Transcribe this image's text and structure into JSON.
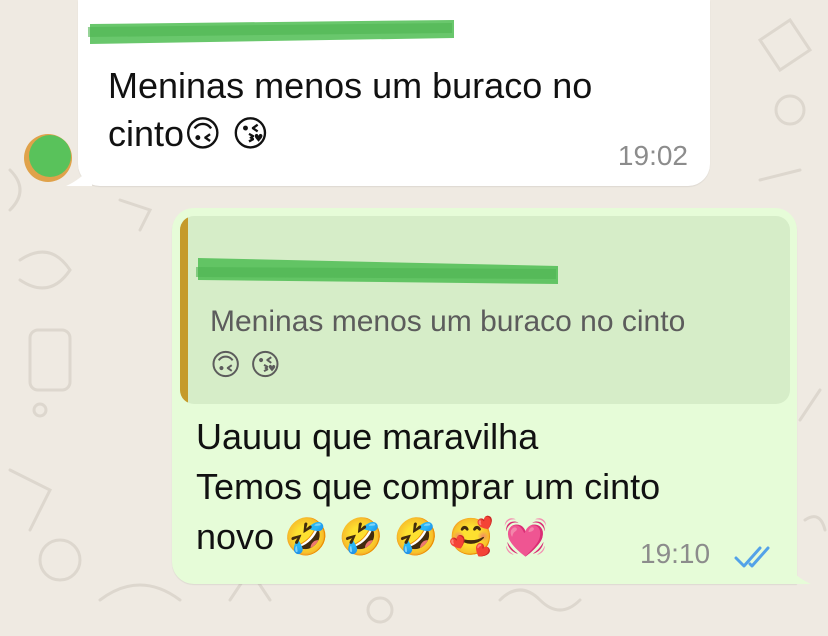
{
  "chat": {
    "incoming": {
      "text_line1": "Meninas menos um buraco no",
      "text_line2": "cinto🙃 😘",
      "time": "19:02"
    },
    "outgoing": {
      "quoted_line1": "Meninas menos um buraco no cinto",
      "quoted_line2": "🙃 😘",
      "line1": "Uauuu que maravilha",
      "line2": "Temos que comprar um cinto",
      "line3": "novo 🤣 🤣 🤣 🥰 💓",
      "time": "19:10",
      "read_status_icon": "double-check-read",
      "read_color": "#53a2e8"
    }
  },
  "colors": {
    "incoming_bubble": "#ffffff",
    "outgoing_bubble": "#e6fcd8",
    "quote_background": "#d6edc8",
    "quote_bar": "#c59a2a",
    "redaction_green": "#5cc25f",
    "wallpaper": "#efeae2"
  }
}
